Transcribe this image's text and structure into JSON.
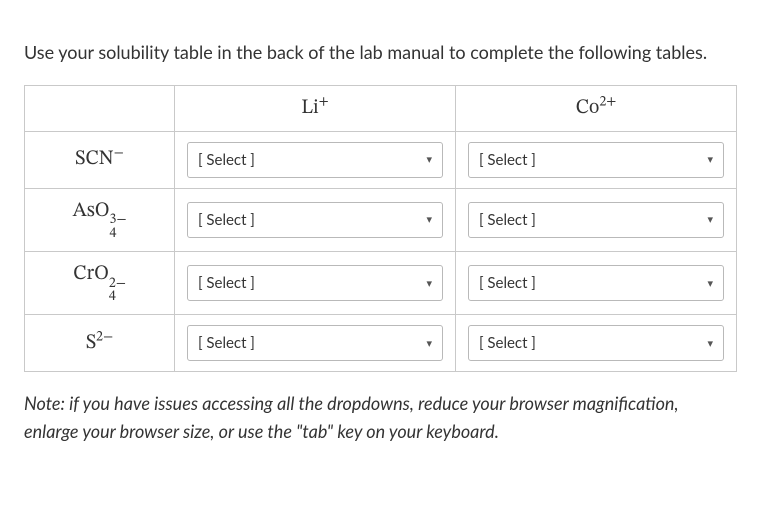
{
  "instructions": "Use your solubility table in the back of the lab manual to complete the following tables.",
  "columns": {
    "blank": "",
    "li": {
      "symbol": "Li",
      "charge": "+"
    },
    "co": {
      "symbol": "Co",
      "charge": "2+"
    }
  },
  "rows": [
    {
      "label": {
        "symbol": "SCN",
        "charge": "−",
        "sub": ""
      }
    },
    {
      "label": {
        "symbol": "AsO",
        "charge": "3−",
        "sub": "4"
      }
    },
    {
      "label": {
        "symbol": "CrO",
        "charge": "2−",
        "sub": "4"
      }
    },
    {
      "label": {
        "symbol": "S",
        "charge": "2−",
        "sub": ""
      }
    }
  ],
  "select_placeholder": "[ Select ]",
  "note": "Note: if you have issues accessing all the dropdowns, reduce your browser magnification, enlarge your browser size, or use the \"tab\" key on your keyboard."
}
